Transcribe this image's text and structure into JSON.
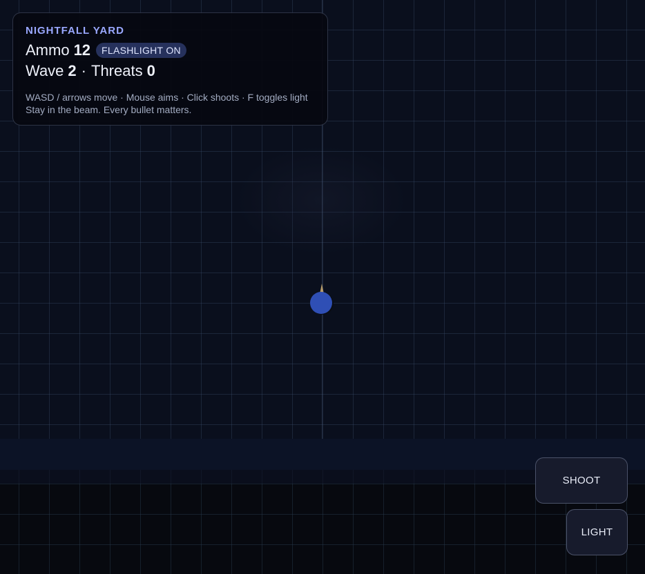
{
  "hud": {
    "title": "NIGHTFALL YARD",
    "ammo_label": "Ammo",
    "ammo_value": "12",
    "flashlight_badge": "FLASHLIGHT ON",
    "wave_label": "Wave",
    "wave_value": "2",
    "separator": "·",
    "threats_label": "Threats",
    "threats_value": "0",
    "help_line_1": "WASD / arrows move · Mouse aims · Click shoots · F toggles light",
    "help_line_2": "Stay in the beam. Every bullet matters."
  },
  "controls": {
    "shoot_label": "SHOOT",
    "light_label": "LIGHT"
  },
  "colors": {
    "accent": "#9aa8ff",
    "badge_bg": "#26315c",
    "player": "#2f4fb5",
    "gun": "#b79b6a",
    "background": "#0a0f1d"
  }
}
